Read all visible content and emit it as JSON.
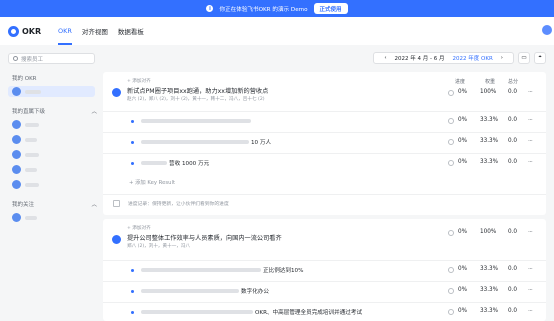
{
  "banner": {
    "text": "你正在体验飞书OKR 的演示 Demo",
    "button": "正式使用"
  },
  "app": {
    "name": "OKR"
  },
  "nav": {
    "tabs": [
      "OKR",
      "对齐视图",
      "数据看板"
    ]
  },
  "sidebar": {
    "search_placeholder": "搜索员工",
    "section_mine": "我的 OKR",
    "section_reports": "我的直属下级",
    "section_follow": "我的关注"
  },
  "toolbar": {
    "period": "2022 年 4 月 - 6 月",
    "current": "2022 年度 OKR"
  },
  "columns": {
    "progress": "进度",
    "weight": "权重",
    "score": "总分"
  },
  "objectives": [
    {
      "add_align": "+ 添加对齐",
      "title": "新试点PM圈子项目xx跑通，助力xx增加新的营收点",
      "owners": "赵六 (2)，郑八 (2)，刘十 (2)，黄十一，韩十二，冯八，吕十七 (2)",
      "progress": "0%",
      "weight": "100%",
      "score": "0.0",
      "krs": [
        {
          "text": "",
          "progress": "0%",
          "weight": "33.3%",
          "score": "0.0"
        },
        {
          "text": "10 万人",
          "progress": "0%",
          "weight": "33.3%",
          "score": "0.0"
        },
        {
          "text": "营收 1000 万元",
          "progress": "0%",
          "weight": "33.3%",
          "score": "0.0"
        }
      ],
      "add_kr": "+ 添加 Key Result",
      "progress_note": "进度记录：保持更新，让小伙伴们看到你的进度"
    },
    {
      "add_align": "+ 添加对齐",
      "title": "提升公司整体工作效率与人员素质，向国内一流公司看齐",
      "owners": "郑八 (2)，刘十，黄十一，冯八",
      "progress": "0%",
      "weight": "100%",
      "score": "0.0",
      "krs": [
        {
          "text": "正比例达到10%",
          "progress": "0%",
          "weight": "33.3%",
          "score": "0.0"
        },
        {
          "text": "数字化办公",
          "progress": "0%",
          "weight": "33.3%",
          "score": "0.0"
        },
        {
          "text": "OKR、中高层管理全员完成培训并通过考试",
          "progress": "0%",
          "weight": "33.3%",
          "score": "0.0"
        }
      ]
    }
  ],
  "colors": {
    "accent": "#3370ff",
    "banner": "#3370ff"
  }
}
